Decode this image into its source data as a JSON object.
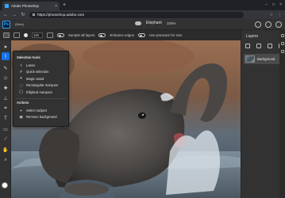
{
  "browser": {
    "tab_title": "Adobe Photoshop",
    "tab_close": "×",
    "new_tab": "+",
    "url": "https://photoshop.adobe.com",
    "window_controls": [
      "–",
      "□",
      "×"
    ]
  },
  "app": {
    "logo": "Ps",
    "beta_label": "(Beta)",
    "document_name": "Elephant",
    "zoom": "100%"
  },
  "options_bar": {
    "size_value": "100",
    "sample_all_layers": "Sample all layers",
    "enhance_edges": "Enhance edges",
    "use_pressure": "Use pressure for size"
  },
  "flyout": {
    "selection_heading": "Selection tools",
    "selection_items": [
      {
        "label": "Lasso",
        "icon": "lasso-icon"
      },
      {
        "label": "Quick selection",
        "icon": "quick-selection-icon"
      },
      {
        "label": "Magic wand",
        "icon": "magic-wand-icon"
      },
      {
        "label": "Rectangular marquee",
        "icon": "rectangular-marquee-icon"
      },
      {
        "label": "Elliptical marquee",
        "icon": "elliptical-marquee-icon"
      }
    ],
    "actions_heading": "Actions",
    "action_items": [
      {
        "label": "Select subject",
        "icon": "select-subject-icon"
      },
      {
        "label": "Remove background",
        "icon": "remove-background-icon"
      }
    ]
  },
  "layers_panel": {
    "title": "Layers",
    "layers": [
      {
        "name": "Background"
      }
    ]
  },
  "colors": {
    "accent": "#1473e6",
    "foreground_swatch": "#ffffff",
    "background_swatch": "#000000"
  }
}
